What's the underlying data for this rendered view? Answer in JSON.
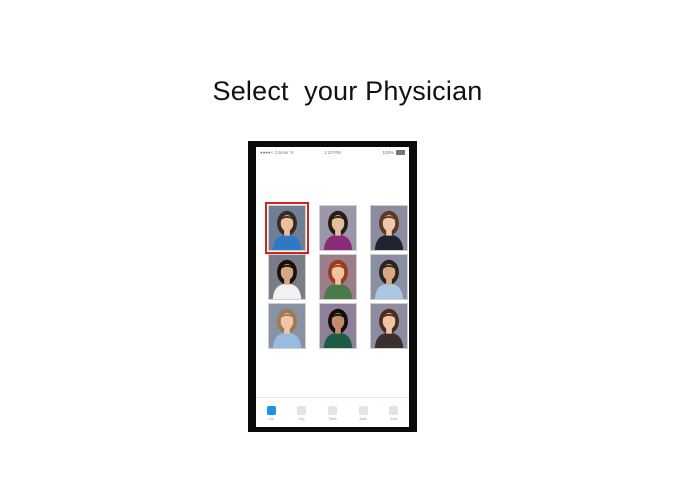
{
  "slide": {
    "title": "Select  your Physician"
  },
  "phone": {
    "status_bar": {
      "carrier": "●●●●○ Carrier ≋",
      "time": "1:20 PM",
      "battery": "100%"
    },
    "physicians": [
      {
        "selected": true,
        "bg": "#6f8096",
        "hair": "#3b2a20",
        "skin": "#e9c1a1",
        "top": "#2f78c4"
      },
      {
        "selected": false,
        "bg": "#9b97a9",
        "hair": "#231d1a",
        "skin": "#e5bd9c",
        "top": "#8a2c79"
      },
      {
        "selected": false,
        "bg": "#8d8da0",
        "hair": "#5a3a26",
        "skin": "#efc8aa",
        "top": "#1f2430"
      },
      {
        "selected": false,
        "bg": "#7a7d86",
        "hair": "#17120f",
        "skin": "#d6a883",
        "top": "#f1f1f1"
      },
      {
        "selected": false,
        "bg": "#9c7d8a",
        "hair": "#9a3b22",
        "skin": "#eec3a2",
        "top": "#4a7a4a"
      },
      {
        "selected": false,
        "bg": "#8b8fa3",
        "hair": "#2a2420",
        "skin": "#d9a882",
        "top": "#a9c6e2"
      },
      {
        "selected": false,
        "bg": "#8992a2",
        "hair": "#9c7a56",
        "skin": "#f0c6a6",
        "top": "#97bce0"
      },
      {
        "selected": false,
        "bg": "#8f8099",
        "hair": "#120f0e",
        "skin": "#c38d6c",
        "top": "#1c5b44"
      },
      {
        "selected": false,
        "bg": "#8e8ca0",
        "hair": "#4a2e1d",
        "skin": "#efc5a5",
        "top": "#3a3030"
      }
    ],
    "tabs": [
      {
        "label": "Doc",
        "active": true
      },
      {
        "label": "Day",
        "active": false
      },
      {
        "label": "Times",
        "active": false
      },
      {
        "label": "Book",
        "active": false
      },
      {
        "label": "Done",
        "active": false
      }
    ]
  }
}
